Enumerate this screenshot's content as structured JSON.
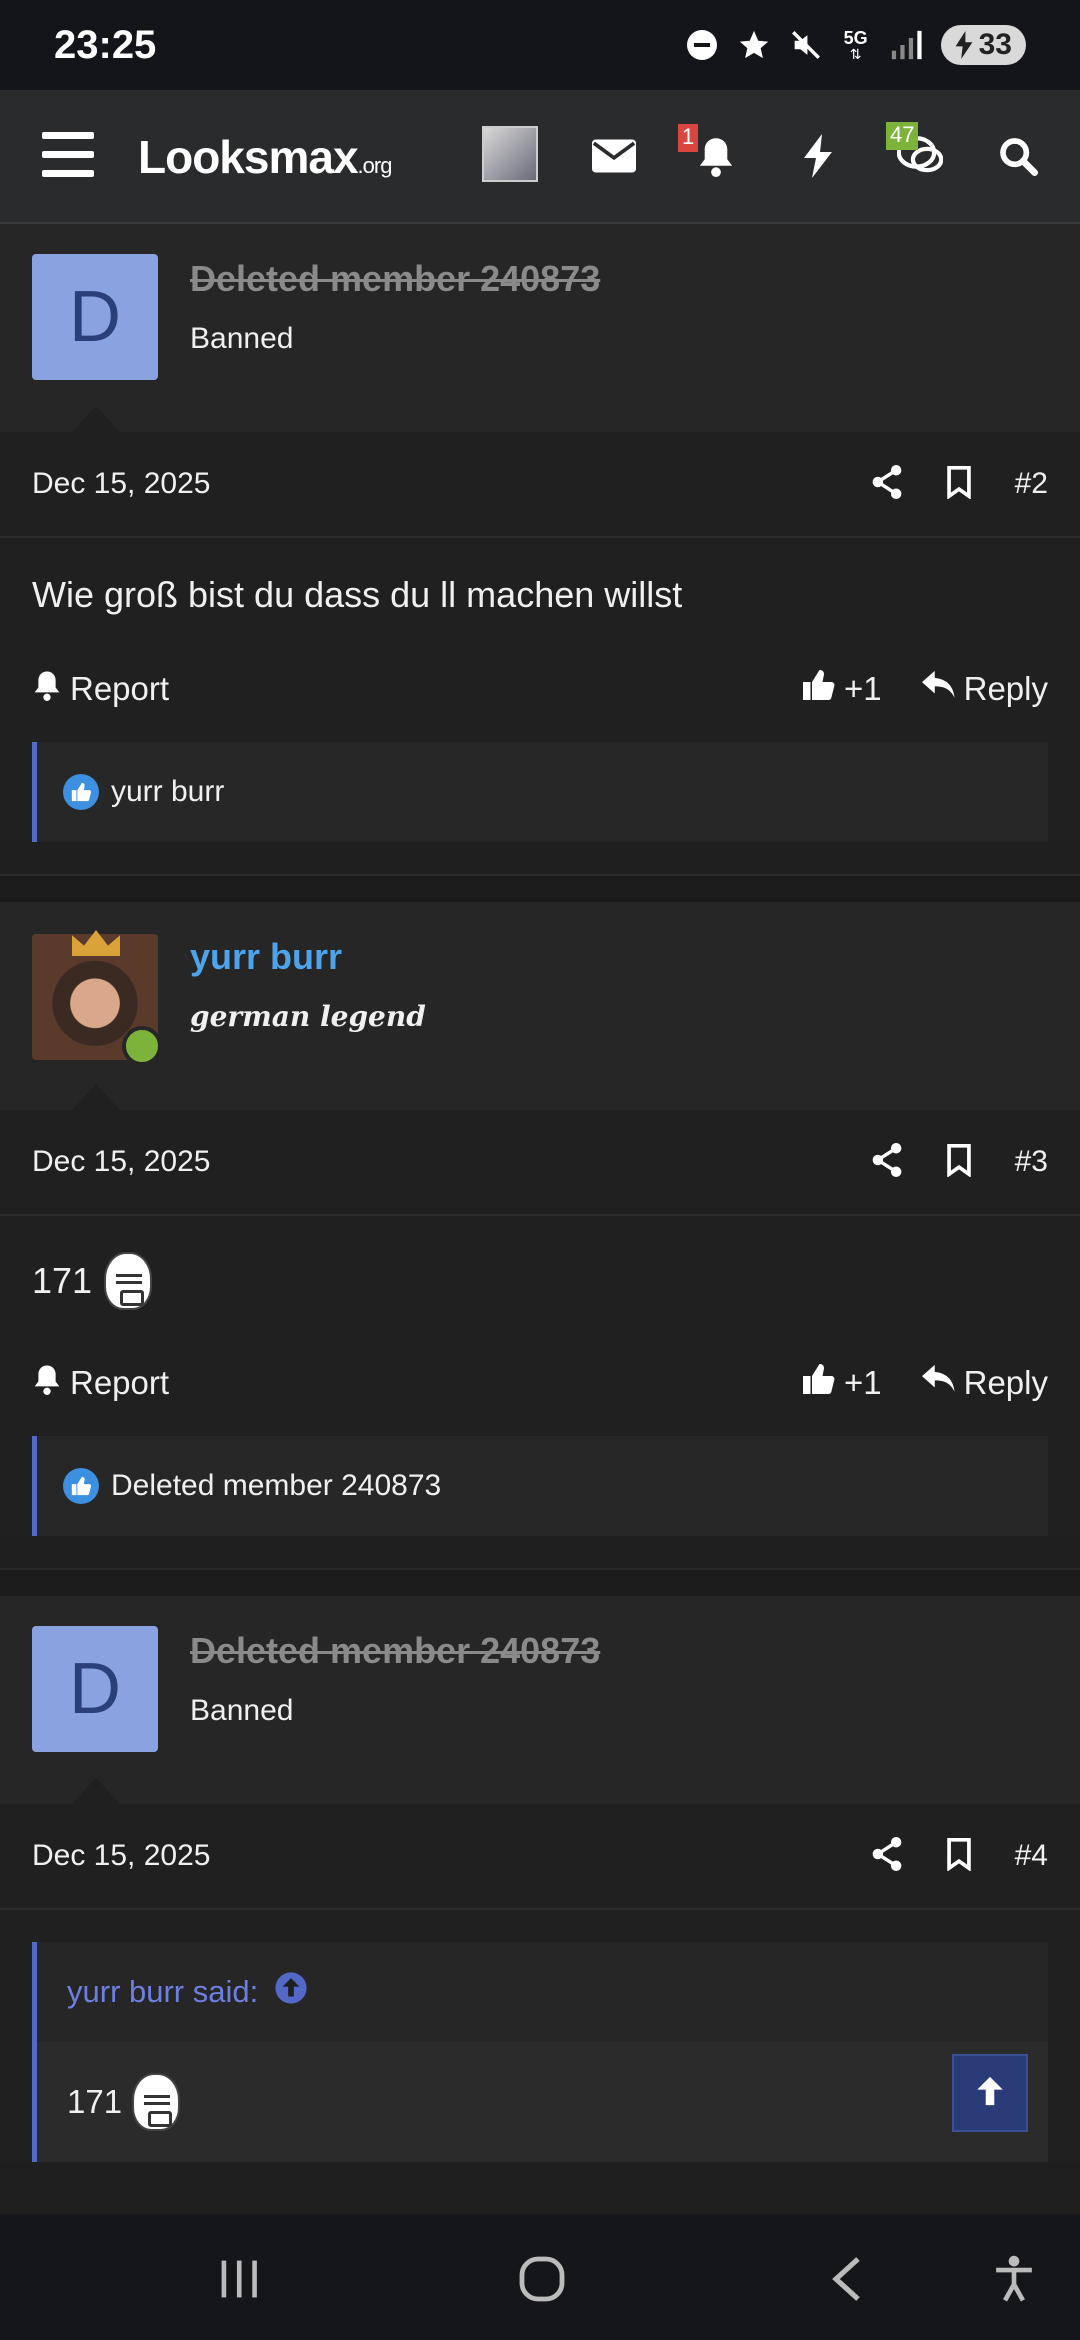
{
  "status_bar": {
    "time": "23:25",
    "network": "5G",
    "battery": "33",
    "icons": [
      "do-not-disturb-icon",
      "star-icon",
      "mute-icon",
      "5g-icon",
      "signal-icon",
      "battery-charging-icon"
    ]
  },
  "navbar": {
    "logo": "Looksmax",
    "logo_suffix": ".org",
    "alerts_badge": "1",
    "chat_badge": "47",
    "icons": [
      "menu-icon",
      "avatar",
      "mail-icon",
      "bell-icon",
      "bolt-icon",
      "chat-icon",
      "search-icon"
    ]
  },
  "posts": [
    {
      "avatar_letter": "D",
      "username": "Deleted member 240873",
      "user_title": "Banned",
      "date": "Dec 15, 2025",
      "post_number": "#2",
      "message": "Wie groß bist du dass du ll machen willst",
      "report_label": "Report",
      "like_count": "+1",
      "reply_label": "Reply",
      "reaction_user": "yurr burr"
    },
    {
      "username": "yurr burr",
      "user_title": "german legend",
      "date": "Dec 15, 2025",
      "post_number": "#3",
      "message": "171",
      "report_label": "Report",
      "like_count": "+1",
      "reply_label": "Reply",
      "reaction_user": "Deleted member 240873"
    },
    {
      "avatar_letter": "D",
      "username": "Deleted member 240873",
      "user_title": "Banned",
      "date": "Dec 15, 2025",
      "post_number": "#4",
      "quote_author": "yurr burr said:",
      "quote_text": "171"
    }
  ],
  "colors": {
    "background": "#1f1f20",
    "accent": "#5468c7",
    "link": "#4fa3ea",
    "alert_badge": "#d9453f",
    "chat_badge": "#7db33a"
  }
}
